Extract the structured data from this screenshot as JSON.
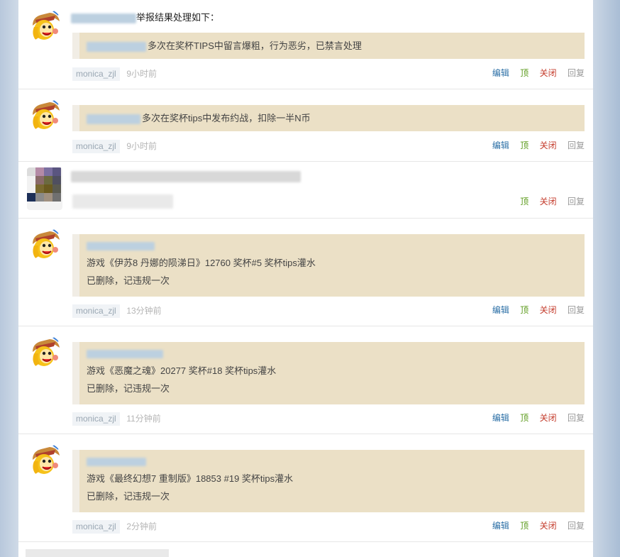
{
  "posts": [
    {
      "header_text": "举报结果处理如下：",
      "quote_lines": [
        "多次在奖杯TIPS中留言爆粗，行为恶劣，已禁言处理"
      ],
      "user": "monica_zjl",
      "time": "9小时前",
      "actions": [
        "编辑",
        "顶",
        "关闭",
        "回复"
      ]
    },
    {
      "quote_lines": [
        "多次在奖杯tips中发布约战，扣除一半N币"
      ],
      "user": "monica_zjl",
      "time": "9小时前",
      "actions": [
        "编辑",
        "顶",
        "关闭",
        "回复"
      ]
    },
    {
      "actions": [
        "顶",
        "关闭",
        "回复"
      ]
    },
    {
      "quote_lines": [
        "游戏《伊苏8 丹娜的陨涕日》12760 奖杯#5 奖杯tips灌水",
        "已删除，记违规一次"
      ],
      "user": "monica_zjl",
      "time": "13分钟前",
      "actions": [
        "编辑",
        "顶",
        "关闭",
        "回复"
      ]
    },
    {
      "quote_lines": [
        "游戏《恶魔之魂》20277 奖杯#18 奖杯tips灌水",
        "已删除，记违规一次"
      ],
      "user": "monica_zjl",
      "time": "11分钟前",
      "actions": [
        "编辑",
        "顶",
        "关闭",
        "回复"
      ]
    },
    {
      "quote_lines": [
        "游戏《最终幻想7 重制版》18853 #19 奖杯tips灌水",
        "已删除，记违规一次"
      ],
      "user": "monica_zjl",
      "time": "2分钟前",
      "actions": [
        "编辑",
        "顶",
        "关闭",
        "回复"
      ]
    }
  ],
  "icons": {
    "avatar": "cartoon-avatar-icon",
    "blurred_avatar": "pixelated-avatar-icon"
  },
  "colors": {
    "quote_bg": "#ebe0c6",
    "edit": "#2b6fa6",
    "top": "#5a9a1a",
    "close": "#c43b2b",
    "reply": "#999999"
  }
}
